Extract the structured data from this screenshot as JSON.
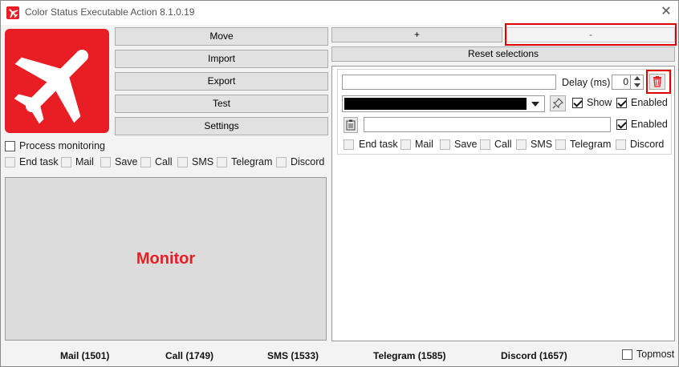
{
  "window": {
    "title": "Color Status Executable Action 8.1.0.19",
    "close_glyph": "✕"
  },
  "left": {
    "buttons": {
      "move": "Move",
      "import": "Import",
      "export": "Export",
      "test": "Test",
      "settings": "Settings"
    },
    "process_monitoring": {
      "label": "Process monitoring",
      "checked": false
    },
    "actions": [
      "End task",
      "Mail",
      "Save",
      "Call",
      "SMS",
      "Telegram",
      "Discord"
    ],
    "monitor_label": "Monitor"
  },
  "right": {
    "add_label": "+",
    "remove_label": "-",
    "reset_label": "Reset selections",
    "entry": {
      "name_value": "",
      "delay_label": "Delay (ms)",
      "delay_value": "0",
      "show_label": "Show",
      "enabled_label": "Enabled",
      "enabled2_label": "Enabled",
      "path_value": "",
      "actions": [
        "End task",
        "Mail",
        "Save",
        "Call",
        "SMS",
        "Telegram",
        "Discord"
      ]
    }
  },
  "status_bar": {
    "mail": "Mail (1501)",
    "call": "Call (1749)",
    "sms": "SMS (1533)",
    "telegram": "Telegram (1585)",
    "discord": "Discord (1657)",
    "topmost": "Topmost"
  },
  "colors": {
    "accent_red": "#e81e24",
    "highlight_red": "#e00000",
    "color_swatch": "#000000"
  }
}
